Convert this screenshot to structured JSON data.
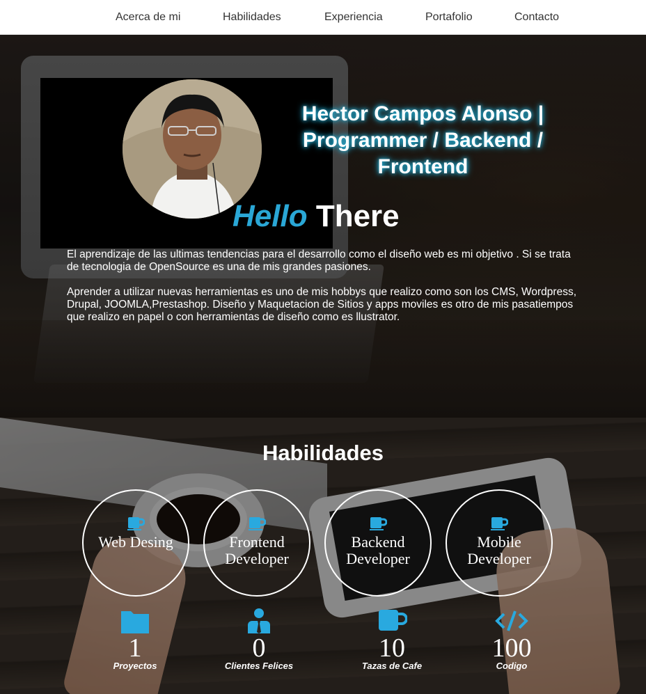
{
  "nav": {
    "items": [
      {
        "label": "Acerca de mi"
      },
      {
        "label": "Habilidades"
      },
      {
        "label": "Experiencia"
      },
      {
        "label": "Portafolio"
      },
      {
        "label": "Contacto"
      }
    ]
  },
  "hero": {
    "title": "Hector Campos Alonso | Programmer / Backend / Frontend",
    "hello_accent": "Hello",
    "hello_rest": "There",
    "paragraph_1": "El aprendizaje de las ultimas tendencias para el desarrollo como el diseño web es mi objetivo . Si se trata de tecnologia de OpenSource es una de mis grandes pasiones.",
    "paragraph_2": "Aprender a utilizar nuevas herramientas es uno de mis hobbys que realizo como son los CMS, Wordpress, Drupal, JOOMLA,Prestashop. Diseño y Maquetacion de Sitios y apps moviles es otro de mis pasatiempos que realizo en papel o con herramientas de diseño como es llustrator."
  },
  "skills": {
    "title": "Habilidades",
    "items": [
      {
        "label": "Web  Desing",
        "icon": "coffee-cup-icon"
      },
      {
        "label": "Frontend Developer",
        "icon": "coffee-cup-icon"
      },
      {
        "label": "Backend Developer",
        "icon": "coffee-cup-icon"
      },
      {
        "label": "Mobile Developer",
        "icon": "coffee-cup-icon"
      }
    ]
  },
  "stats": [
    {
      "value": "1",
      "label": "Proyectos",
      "icon": "folder-icon"
    },
    {
      "value": "0",
      "label": "Clientes Felices",
      "icon": "user-tie-icon"
    },
    {
      "value": "10",
      "label": "Tazas de Cafe",
      "icon": "coffee-cup-icon"
    },
    {
      "value": "100",
      "label": "Codigo",
      "icon": "code-icon"
    }
  ],
  "colors": {
    "accent": "#2aa7d6",
    "nav_bg": "#ffffff",
    "text_light": "#ffffff"
  }
}
